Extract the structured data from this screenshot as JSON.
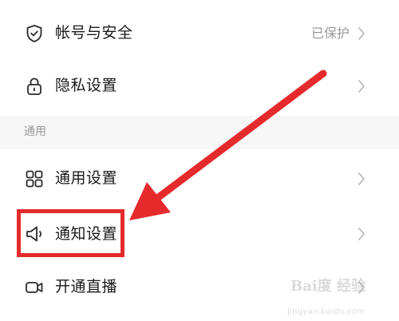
{
  "settings": {
    "account": {
      "label": "帐号与安全",
      "value": "已保护",
      "icon": "shield-icon"
    },
    "privacy": {
      "label": "隐私设置",
      "icon": "lock-icon"
    },
    "section_general": "通用",
    "general": {
      "label": "通用设置",
      "icon": "grid-icon"
    },
    "notification": {
      "label": "通知设置",
      "icon": "speaker-icon"
    },
    "live": {
      "label": "开通直播",
      "icon": "video-camera-icon"
    }
  },
  "annotation": {
    "color": "#e52a2c",
    "target": "notification"
  },
  "watermark": {
    "brand": "Bai度 经验",
    "url": "jingyan.baidu.com"
  },
  "colors": {
    "text": "#1a1a1a",
    "secondary": "#9a9a9a",
    "section_bg": "#f7f7f8",
    "accent_red": "#e52a2c"
  }
}
